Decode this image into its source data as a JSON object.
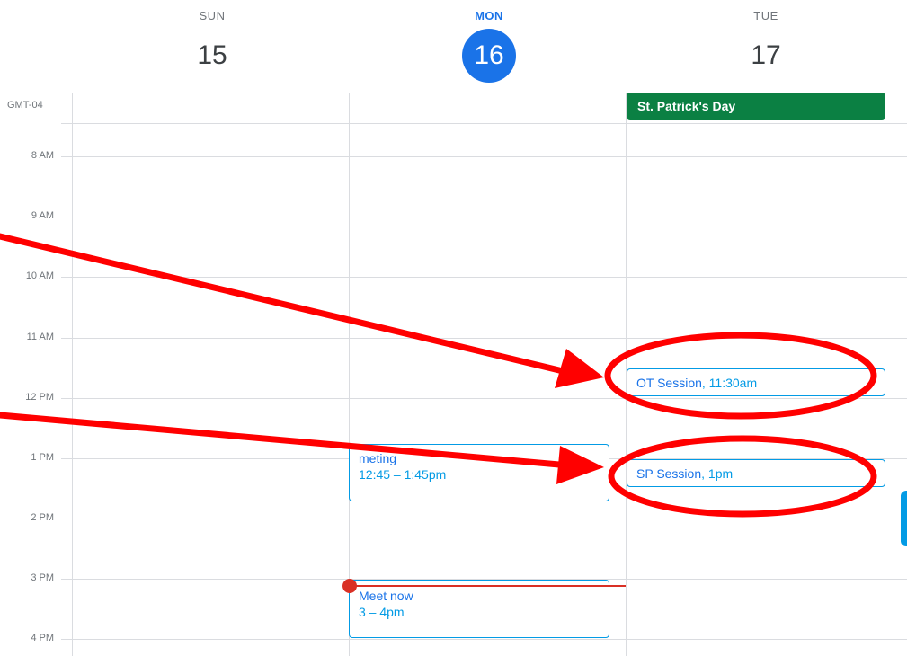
{
  "days": [
    {
      "dow": "SUN",
      "num": "15"
    },
    {
      "dow": "MON",
      "num": "16"
    },
    {
      "dow": "TUE",
      "num": "17"
    }
  ],
  "timezone": "GMT-04",
  "hours": [
    "8 AM",
    "9 AM",
    "10 AM",
    "11 AM",
    "12 PM",
    "1 PM",
    "2 PM",
    "3 PM",
    "4 PM"
  ],
  "allday_event": "St. Patrick's Day",
  "events": {
    "ot": {
      "title": "OT Session",
      "time": "11:30am"
    },
    "sp": {
      "title": "SP Session",
      "time": "1pm"
    },
    "meeting": {
      "title": "meting",
      "time": "12:45 – 1:45pm"
    },
    "meetnow": {
      "title": "Meet now",
      "time": "3 – 4pm"
    }
  },
  "colors": {
    "today": "#1a73e8",
    "holiday": "#0b8043",
    "event_border": "#039be5",
    "now_indicator": "#d93025",
    "annotation": "#ff0000"
  }
}
